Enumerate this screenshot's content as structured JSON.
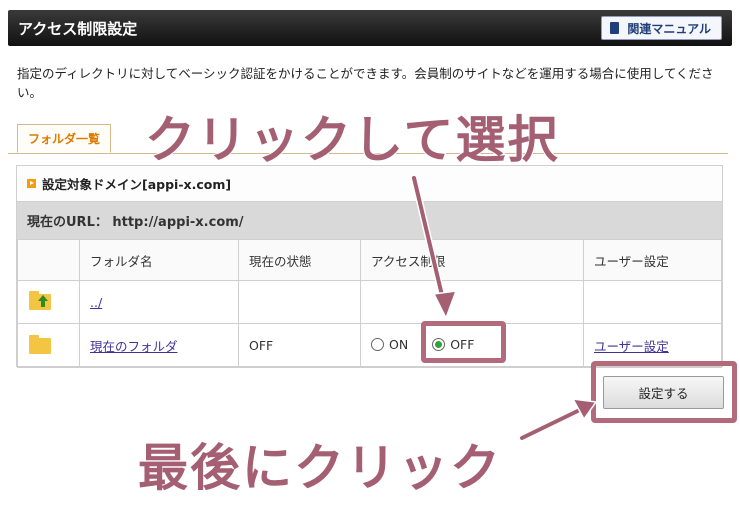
{
  "header": {
    "title": "アクセス制限設定",
    "manual_label": "関連マニュアル"
  },
  "intro": "指定のディレクトリに対してベーシック認証をかけることができます。会員制のサイトなどを運用する場合に使用してください。",
  "tab": {
    "label": "フォルダ一覧"
  },
  "panel": {
    "domain_label": "設定対象ドメイン[appi-x.com]",
    "url_label": "現在のURL： http://appi-x.com/"
  },
  "table": {
    "headers": [
      "",
      "フォルダ名",
      "現在の状態",
      "アクセス制限",
      "ユーザー設定"
    ],
    "rows": [
      {
        "name": "../",
        "state": "",
        "user": ""
      },
      {
        "name": "現在のフォルダ",
        "state": "OFF",
        "user": "ユーザー設定"
      }
    ],
    "radio_on": "ON",
    "radio_off": "OFF",
    "selected": "OFF"
  },
  "submit_label": "設定する",
  "annotations": {
    "top": "クリックして選択",
    "bottom": "最後にクリック",
    "color": "#a45f73"
  }
}
